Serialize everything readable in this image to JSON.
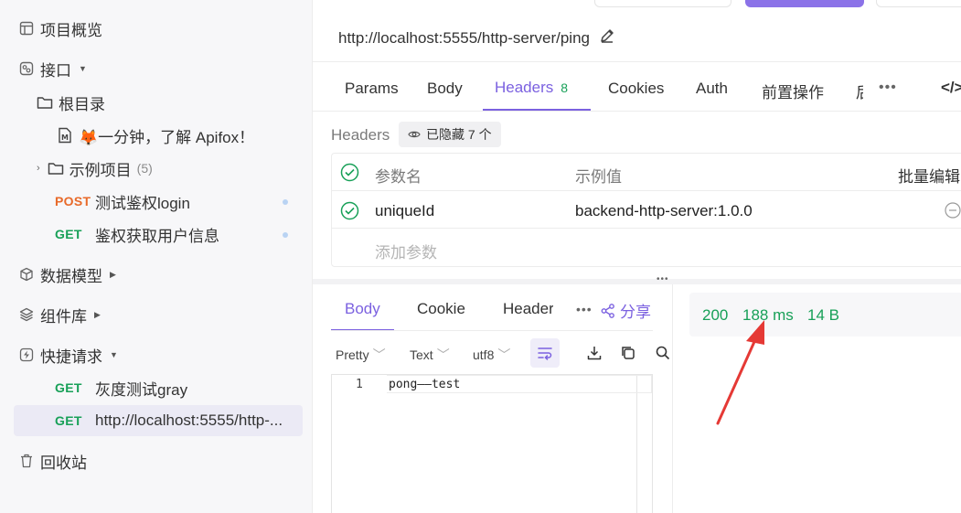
{
  "sidebar": {
    "overview": "项目概览",
    "interfaces": "接口",
    "root": "根目录",
    "doc_item": "🦊一分钟，了解 Apifox！",
    "examples": "示例项目",
    "examples_count": "(5)",
    "api1": {
      "method": "POST",
      "name": "测试鉴权login"
    },
    "api2": {
      "method": "GET",
      "name": "鉴权获取用户信息"
    },
    "models": "数据模型",
    "components": "组件库",
    "quick_requests": "快捷请求",
    "qr1": {
      "method": "GET",
      "name": "灰度测试gray"
    },
    "qr2": {
      "method": "GET",
      "name": "http://localhost:5555/http-..."
    },
    "trash": "回收站"
  },
  "request": {
    "url": "http://localhost:5555/http-server/ping",
    "tabs": {
      "params": "Params",
      "body": "Body",
      "headers": "Headers",
      "headers_count": "8",
      "cookies": "Cookies",
      "auth": "Auth",
      "pre_ops": "前置操作",
      "cut": "后"
    },
    "headers_label": "Headers",
    "hidden_pill": "已隐藏 7 个",
    "table": {
      "col_name": "参数名",
      "col_example": "示例值",
      "bulk_edit": "批量编辑",
      "row1_name": "uniqueId",
      "row1_value": "backend-http-server:1.0.0",
      "add_param": "添加参数"
    }
  },
  "response": {
    "tabs": {
      "body": "Body",
      "cookie": "Cookie",
      "header": "Header",
      "share": "分享"
    },
    "format": {
      "pretty": "Pretty",
      "text": "Text",
      "encoding": "utf8"
    },
    "code_line_no": "1",
    "code_line": "pong——test",
    "status": {
      "code": "200",
      "time": "188 ms",
      "size": "14 B"
    }
  },
  "colors": {
    "accent": "#7b61e0",
    "get": "#18a058",
    "post": "#e86a2a",
    "arrow": "#e53935"
  }
}
